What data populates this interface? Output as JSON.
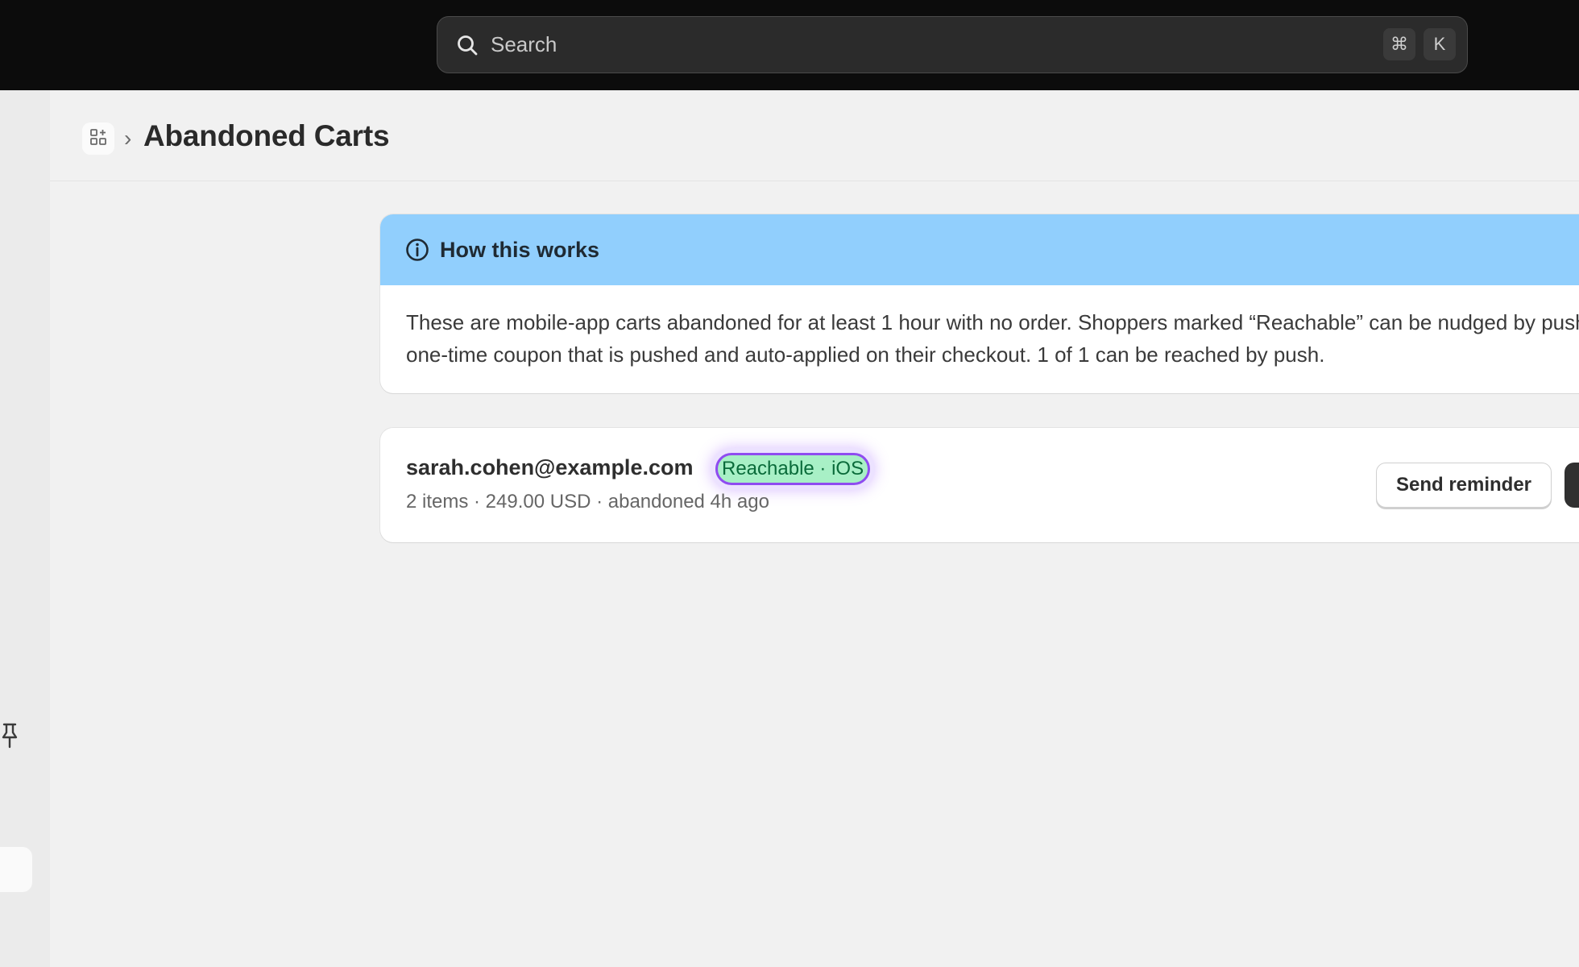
{
  "search": {
    "placeholder": "Search",
    "shortcut_keys": [
      "⌘",
      "K"
    ]
  },
  "header": {
    "title": "Abandoned Carts",
    "separator": "›"
  },
  "info": {
    "title": "How this works",
    "body": "These are mobile-app carts abandoned for at least 1 hour with no order. Shoppers marked “Reachable” can be nudged by push, or create a one-time coupon that is pushed and auto-applied on their checkout. 1 of 1 can be reached by push."
  },
  "carts": [
    {
      "email": "sarah.cohen@example.com",
      "badge": "Reachable · iOS",
      "meta": "2 items · 249.00 USD · abandoned 4h ago",
      "send_label": "Send reminder"
    }
  ],
  "colors": {
    "topbar": "#0c0c0c",
    "info_header": "#91cffd",
    "badge_bg": "#a8f0c6",
    "badge_border": "#8f4cf0"
  }
}
